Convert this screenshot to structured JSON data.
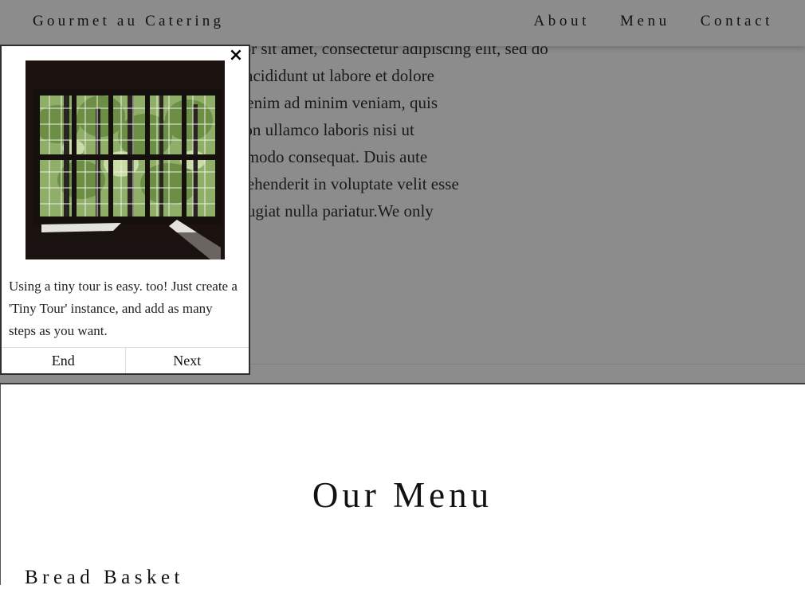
{
  "nav": {
    "brand": "Gourmet au Catering",
    "links": [
      "About",
      "Menu",
      "Contact"
    ]
  },
  "about": {
    "lines": [
      "Lorem ipsum dolor sit amet, consectetur adipiscing elit, sed do",
      "eiusmod tempor incididunt ut labore et dolore",
      "magna aliqua. Ut enim ad minim veniam, quis",
      "nostrud exercitation ullamco laboris nisi ut",
      "aliquip ex ea commodo consequat. Duis aute",
      "irure dolor in reprehenderit in voluptate velit esse",
      "cillum dolore eu fugiat nulla pariatur.We only"
    ]
  },
  "menu": {
    "title": "Our Menu",
    "first_category": "Bread Basket"
  },
  "tour": {
    "close_symbol": "×",
    "text": "Using a tiny tour is easy. too! Just create a 'Tiny Tour' instance, and add as many steps as you want.",
    "end_label": "End",
    "next_label": "Next",
    "image": "window-with-trees-image"
  }
}
